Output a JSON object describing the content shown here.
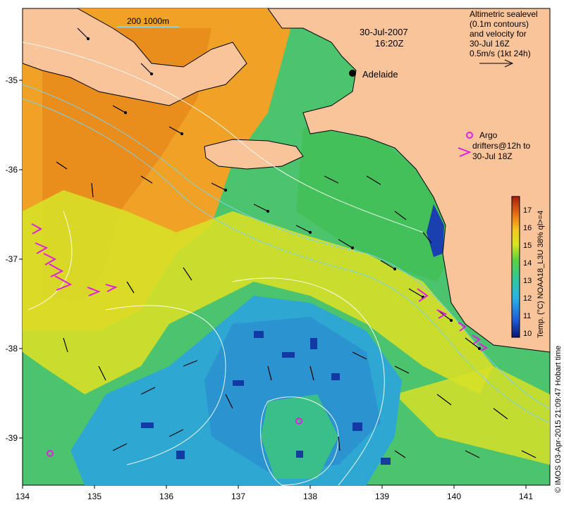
{
  "date_label": "30-Jul-2007",
  "time_label": "16:20Z",
  "depth_legend": "200  1000m",
  "city_label": "Adelaide",
  "altimetry_note": [
    "Altimetric sealevel",
    "(0.1m contours)",
    "and velocity for",
    "30-Jul 16Z",
    "0.5m/s (1kt 24h)"
  ],
  "argo_note": [
    "Argo",
    "drifters@12h to",
    "30-Jul 18Z"
  ],
  "colorbar_title": "Temp. (°C) NOAA18_L3U 38% ql>=4",
  "colorbar_ticks": [
    "10",
    "11",
    "12",
    "13",
    "14",
    "15",
    "16",
    "17"
  ],
  "credit_text": "© IMOS 03-Apr-2015 21:09:47 Hobart time",
  "x_ticks": [
    "134",
    "135",
    "136",
    "137",
    "138",
    "139",
    "140",
    "141"
  ],
  "y_ticks": [
    "-35",
    "-36",
    "-37",
    "-38",
    "-39"
  ],
  "colors": {
    "land": "#f9c49a",
    "cool": "#2c9cd8",
    "warm": "#f5a524",
    "argo": "#e020e0"
  }
}
